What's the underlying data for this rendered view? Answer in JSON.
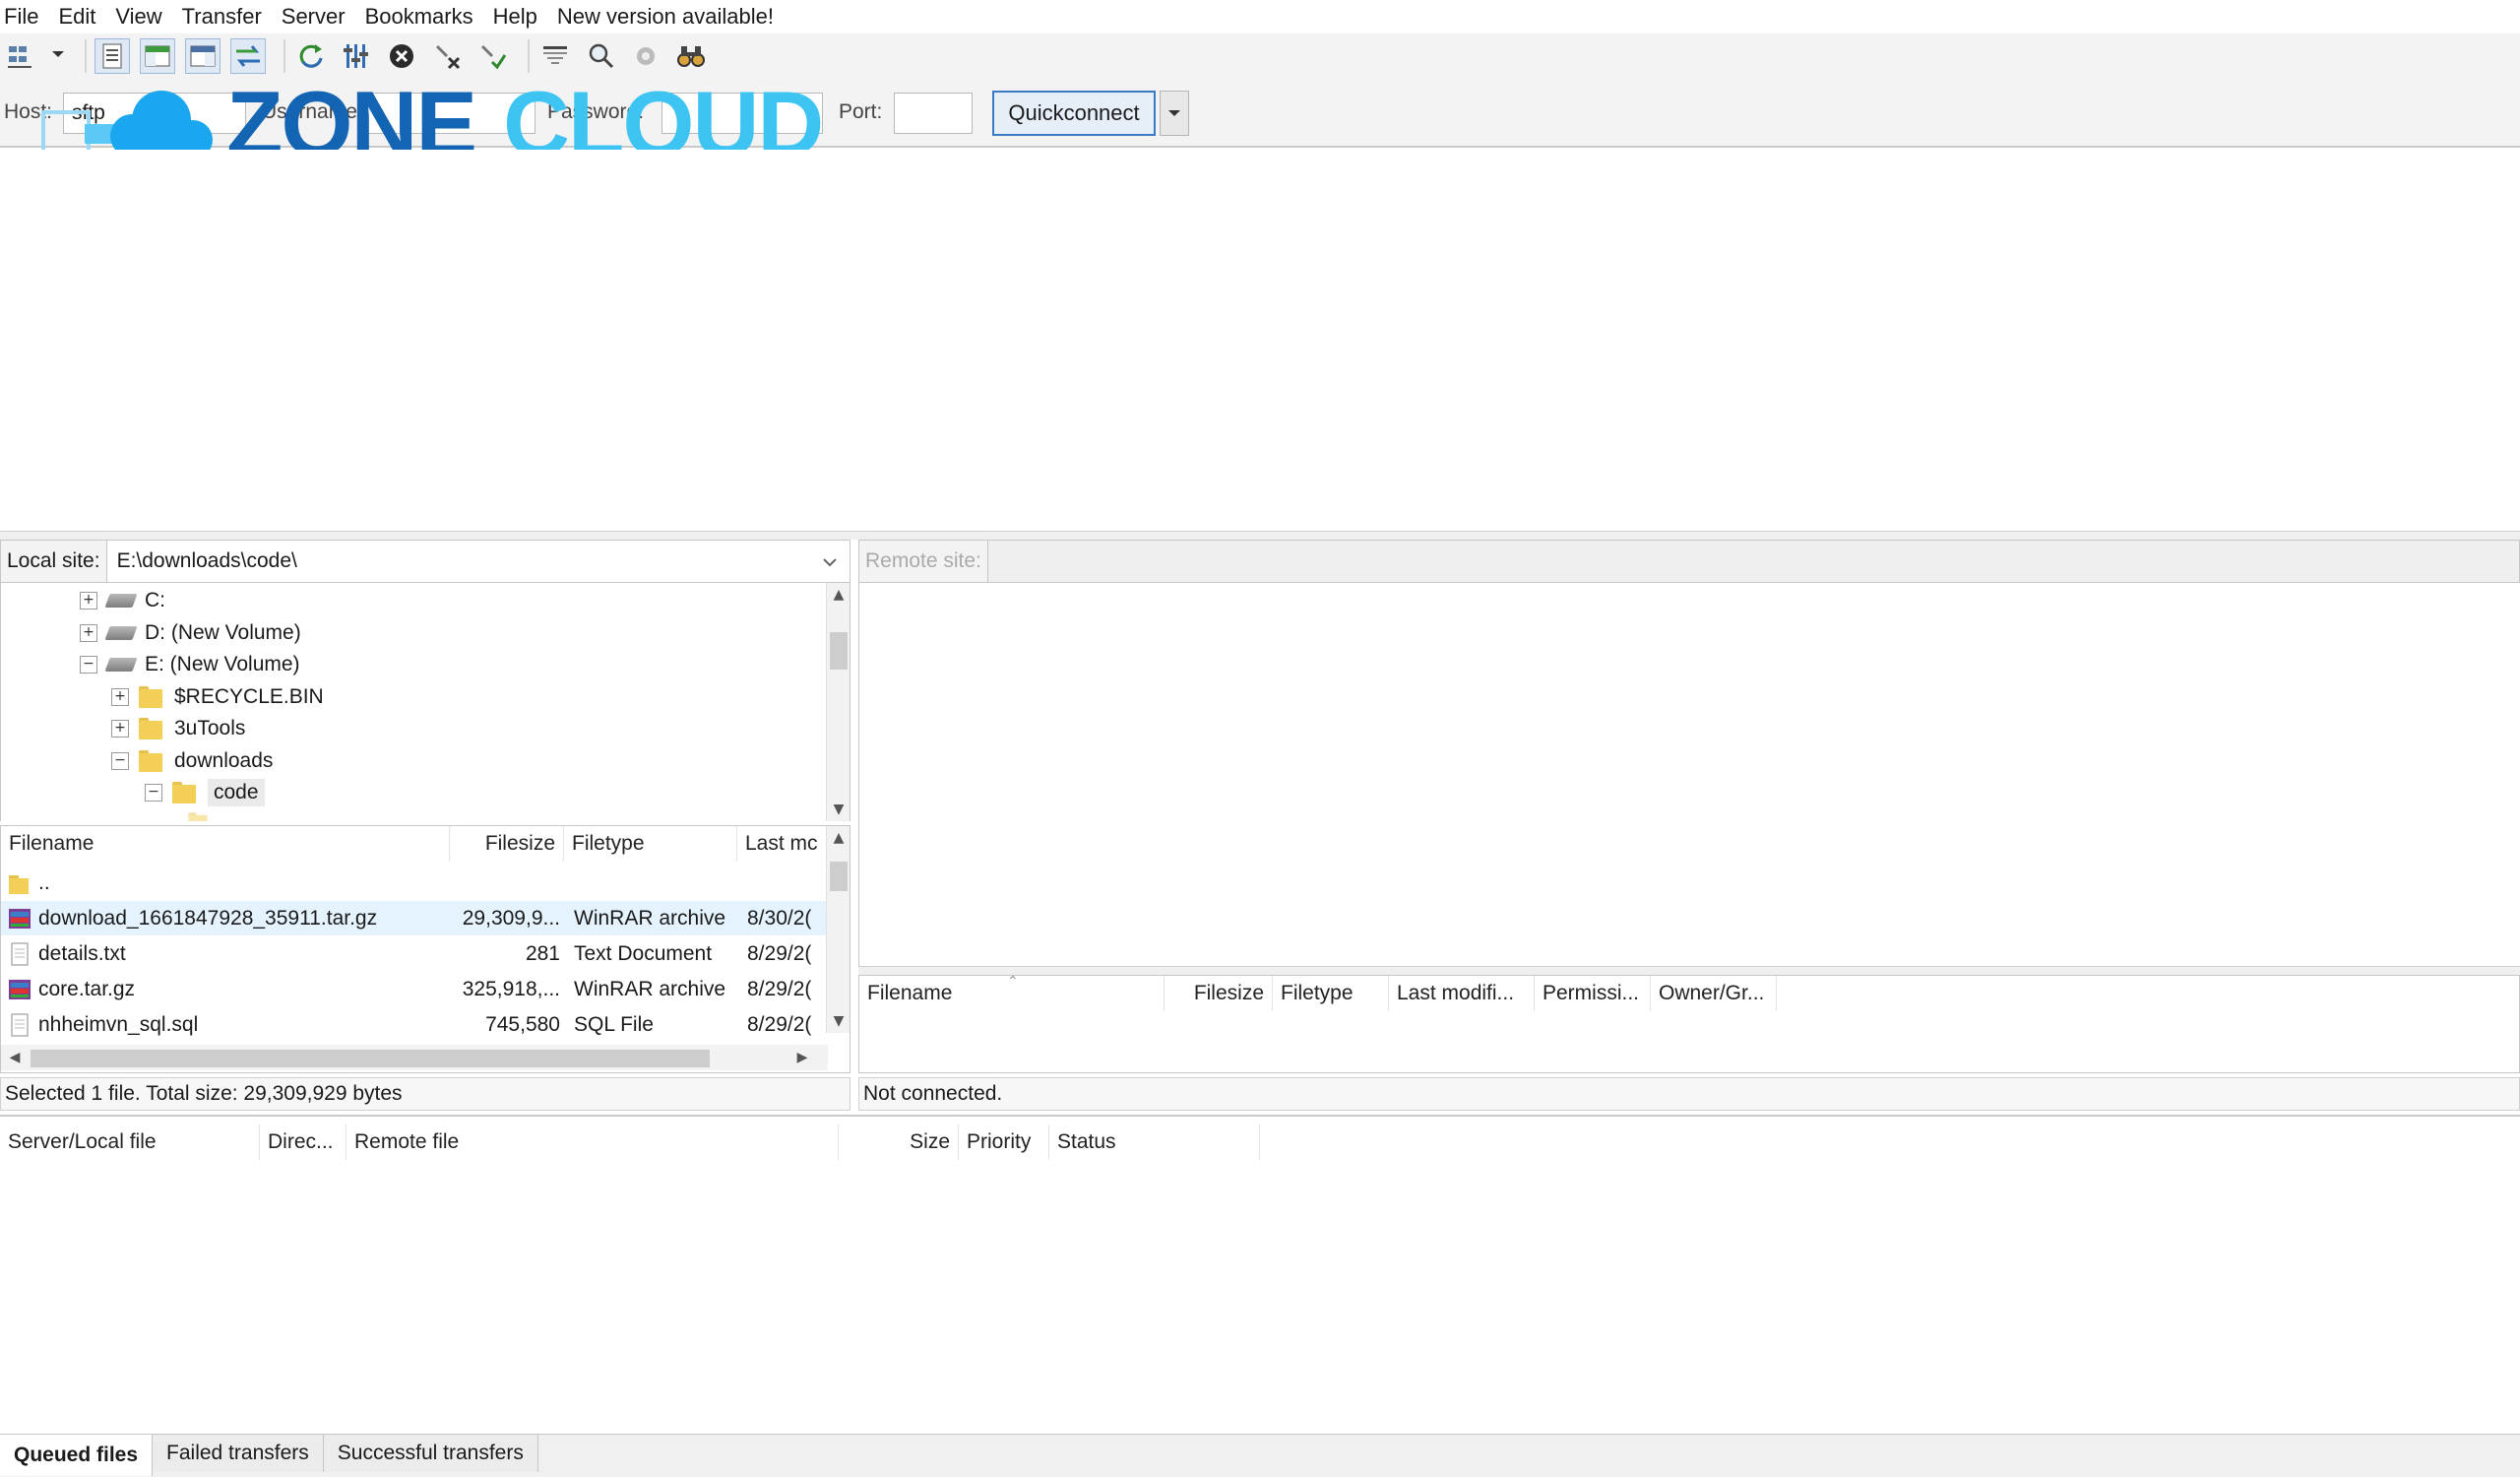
{
  "menu": [
    "File",
    "Edit",
    "View",
    "Transfer",
    "Server",
    "Bookmarks",
    "Help",
    "New version available!"
  ],
  "toolbar_icons": [
    "site-manager-icon",
    "dropdown-arrow-icon",
    "toggle-message-log-icon",
    "toggle-local-tree-icon",
    "toggle-remote-tree-icon",
    "toggle-transfer-queue-icon",
    "refresh-icon",
    "process-queue-icon",
    "cancel-icon",
    "disconnect-icon",
    "reconnect-icon",
    "filter-icon",
    "search-icon",
    "compare-icon",
    "binoculars-icon"
  ],
  "quickconnect": {
    "host_label": "Host:",
    "host_value": "sftp",
    "username_label": "Username:",
    "password_label": "Password:",
    "port_label": "Port:",
    "button": "Quickconnect"
  },
  "watermark": {
    "part1": "ZONE",
    "part2": "CLOUD"
  },
  "local": {
    "site_label": "Local site:",
    "path": "E:\\downloads\\code\\",
    "tree": [
      {
        "label": "C:",
        "indent": 0,
        "type": "drive",
        "sign": "+"
      },
      {
        "label": "D: (New Volume)",
        "indent": 0,
        "type": "drive",
        "sign": "+"
      },
      {
        "label": "E: (New Volume)",
        "indent": 0,
        "type": "drive",
        "sign": "−"
      },
      {
        "label": "$RECYCLE.BIN",
        "indent": 1,
        "type": "folder",
        "sign": "+"
      },
      {
        "label": "3uTools",
        "indent": 1,
        "type": "folder",
        "sign": "+"
      },
      {
        "label": "downloads",
        "indent": 1,
        "type": "folder",
        "sign": "−"
      },
      {
        "label": "code",
        "indent": 2,
        "type": "folder",
        "sign": "−",
        "selected": true
      }
    ],
    "columns": [
      "Filename",
      "Filesize",
      "Filetype",
      "Last mc"
    ],
    "files": [
      {
        "name": "..",
        "size": "",
        "type": "",
        "modified": "",
        "icon": "folder"
      },
      {
        "name": "download_1661847928_35911.tar.gz",
        "size": "29,309,9...",
        "type": "WinRAR archive",
        "modified": "8/30/2(",
        "icon": "rar",
        "selected": true
      },
      {
        "name": "details.txt",
        "size": "281",
        "type": "Text Document",
        "modified": "8/29/2(",
        "icon": "txt"
      },
      {
        "name": "core.tar.gz",
        "size": "325,918,...",
        "type": "WinRAR archive",
        "modified": "8/29/2(",
        "icon": "rar"
      },
      {
        "name": "nhheimvn_sql.sql",
        "size": "745,580",
        "type": "SQL File",
        "modified": "8/29/2(",
        "icon": "txt"
      }
    ],
    "status": "Selected 1 file. Total size: 29,309,929 bytes"
  },
  "remote": {
    "site_label": "Remote site:",
    "path": "",
    "columns": [
      "Filename",
      "Filesize",
      "Filetype",
      "Last modifi...",
      "Permissi...",
      "Owner/Gr..."
    ],
    "status": "Not connected."
  },
  "queue": {
    "columns": [
      "Server/Local file",
      "Direc...",
      "Remote file",
      "Size",
      "Priority",
      "Status"
    ],
    "tabs": [
      "Queued files",
      "Failed transfers",
      "Successful transfers"
    ]
  },
  "colors": {
    "accent": "#3a79c6",
    "selection": "#e5f3ff",
    "logo_dark": "#1464b4",
    "logo_light": "#3ec4f2"
  }
}
